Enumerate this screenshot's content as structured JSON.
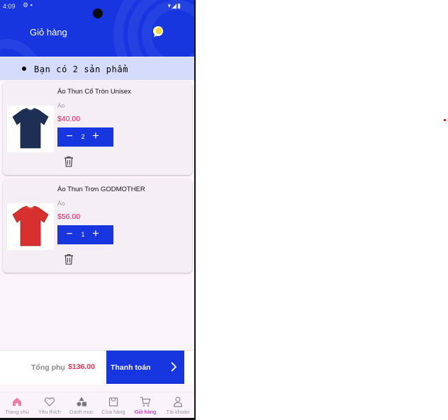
{
  "status_bar": {
    "time": "4:09"
  },
  "header": {
    "title": "Giỏ hàng",
    "chat_icon": "chat-bubble-icon"
  },
  "cart_summary": {
    "text": "Bạn có 2 sản phẩm"
  },
  "items": [
    {
      "name": "Áo Thun Cổ Tròn Unisex",
      "category": "Áo",
      "price": "$40.00",
      "quantity": "2",
      "image": "navy-tshirt",
      "color": "#1e2f56"
    },
    {
      "name": "Áo Thun Trơn GODMOTHER",
      "category": "Áo",
      "price": "$56.00",
      "quantity": "1",
      "image": "red-tshirt",
      "color": "#d8302e"
    }
  ],
  "footer": {
    "subtotal_label": "Tổng phụ",
    "subtotal_value": "$136.00",
    "checkout_label": "Thanh toán"
  },
  "nav": [
    {
      "label": "Trang chủ",
      "icon": "home-icon"
    },
    {
      "label": "Yêu thích",
      "icon": "heart-icon"
    },
    {
      "label": "Danh mục",
      "icon": "category-icon"
    },
    {
      "label": "Cửa hàng",
      "icon": "store-icon"
    },
    {
      "label": "Giỏ hàng",
      "icon": "cart-icon",
      "active": true
    },
    {
      "label": "Tài khoản",
      "icon": "account-icon"
    }
  ],
  "colors": {
    "primary": "#1736e0",
    "price": "#e01c5a",
    "active_nav": "#b01aa4",
    "background": "#fcf4fb",
    "banner": "#d5dcfb"
  }
}
